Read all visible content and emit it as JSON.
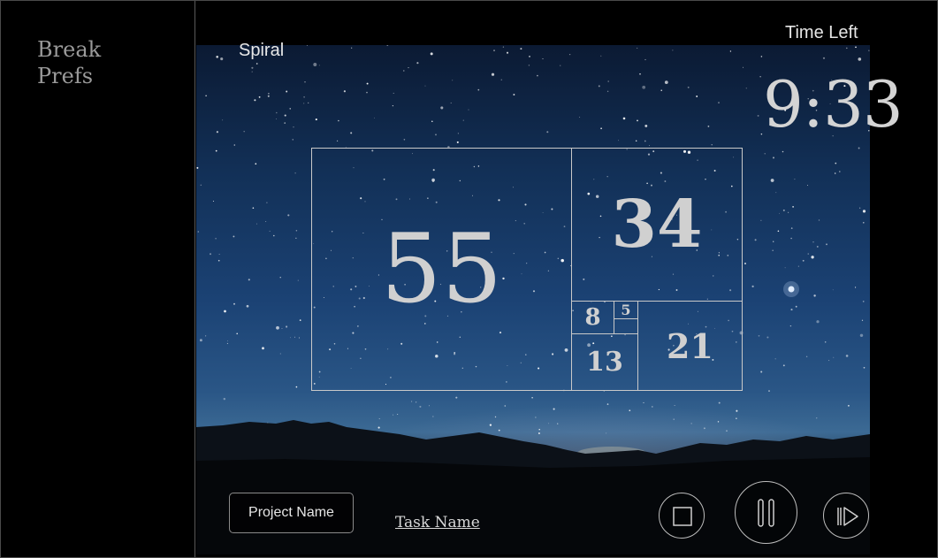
{
  "sidebar": {
    "items": [
      {
        "label": "Break"
      },
      {
        "label": "Prefs"
      }
    ]
  },
  "main": {
    "mode_label": "Spiral",
    "timer": {
      "label": "Time Left",
      "value": "9:33"
    },
    "fibonacci": {
      "squares": [
        "55",
        "34",
        "21",
        "13",
        "8",
        "5"
      ]
    },
    "project_name": "Project Name",
    "task_name": "Task Name",
    "controls": {
      "stop_icon": "stop-icon",
      "pause_icon": "pause-icon",
      "skip_icon": "skip-forward-icon"
    }
  }
}
